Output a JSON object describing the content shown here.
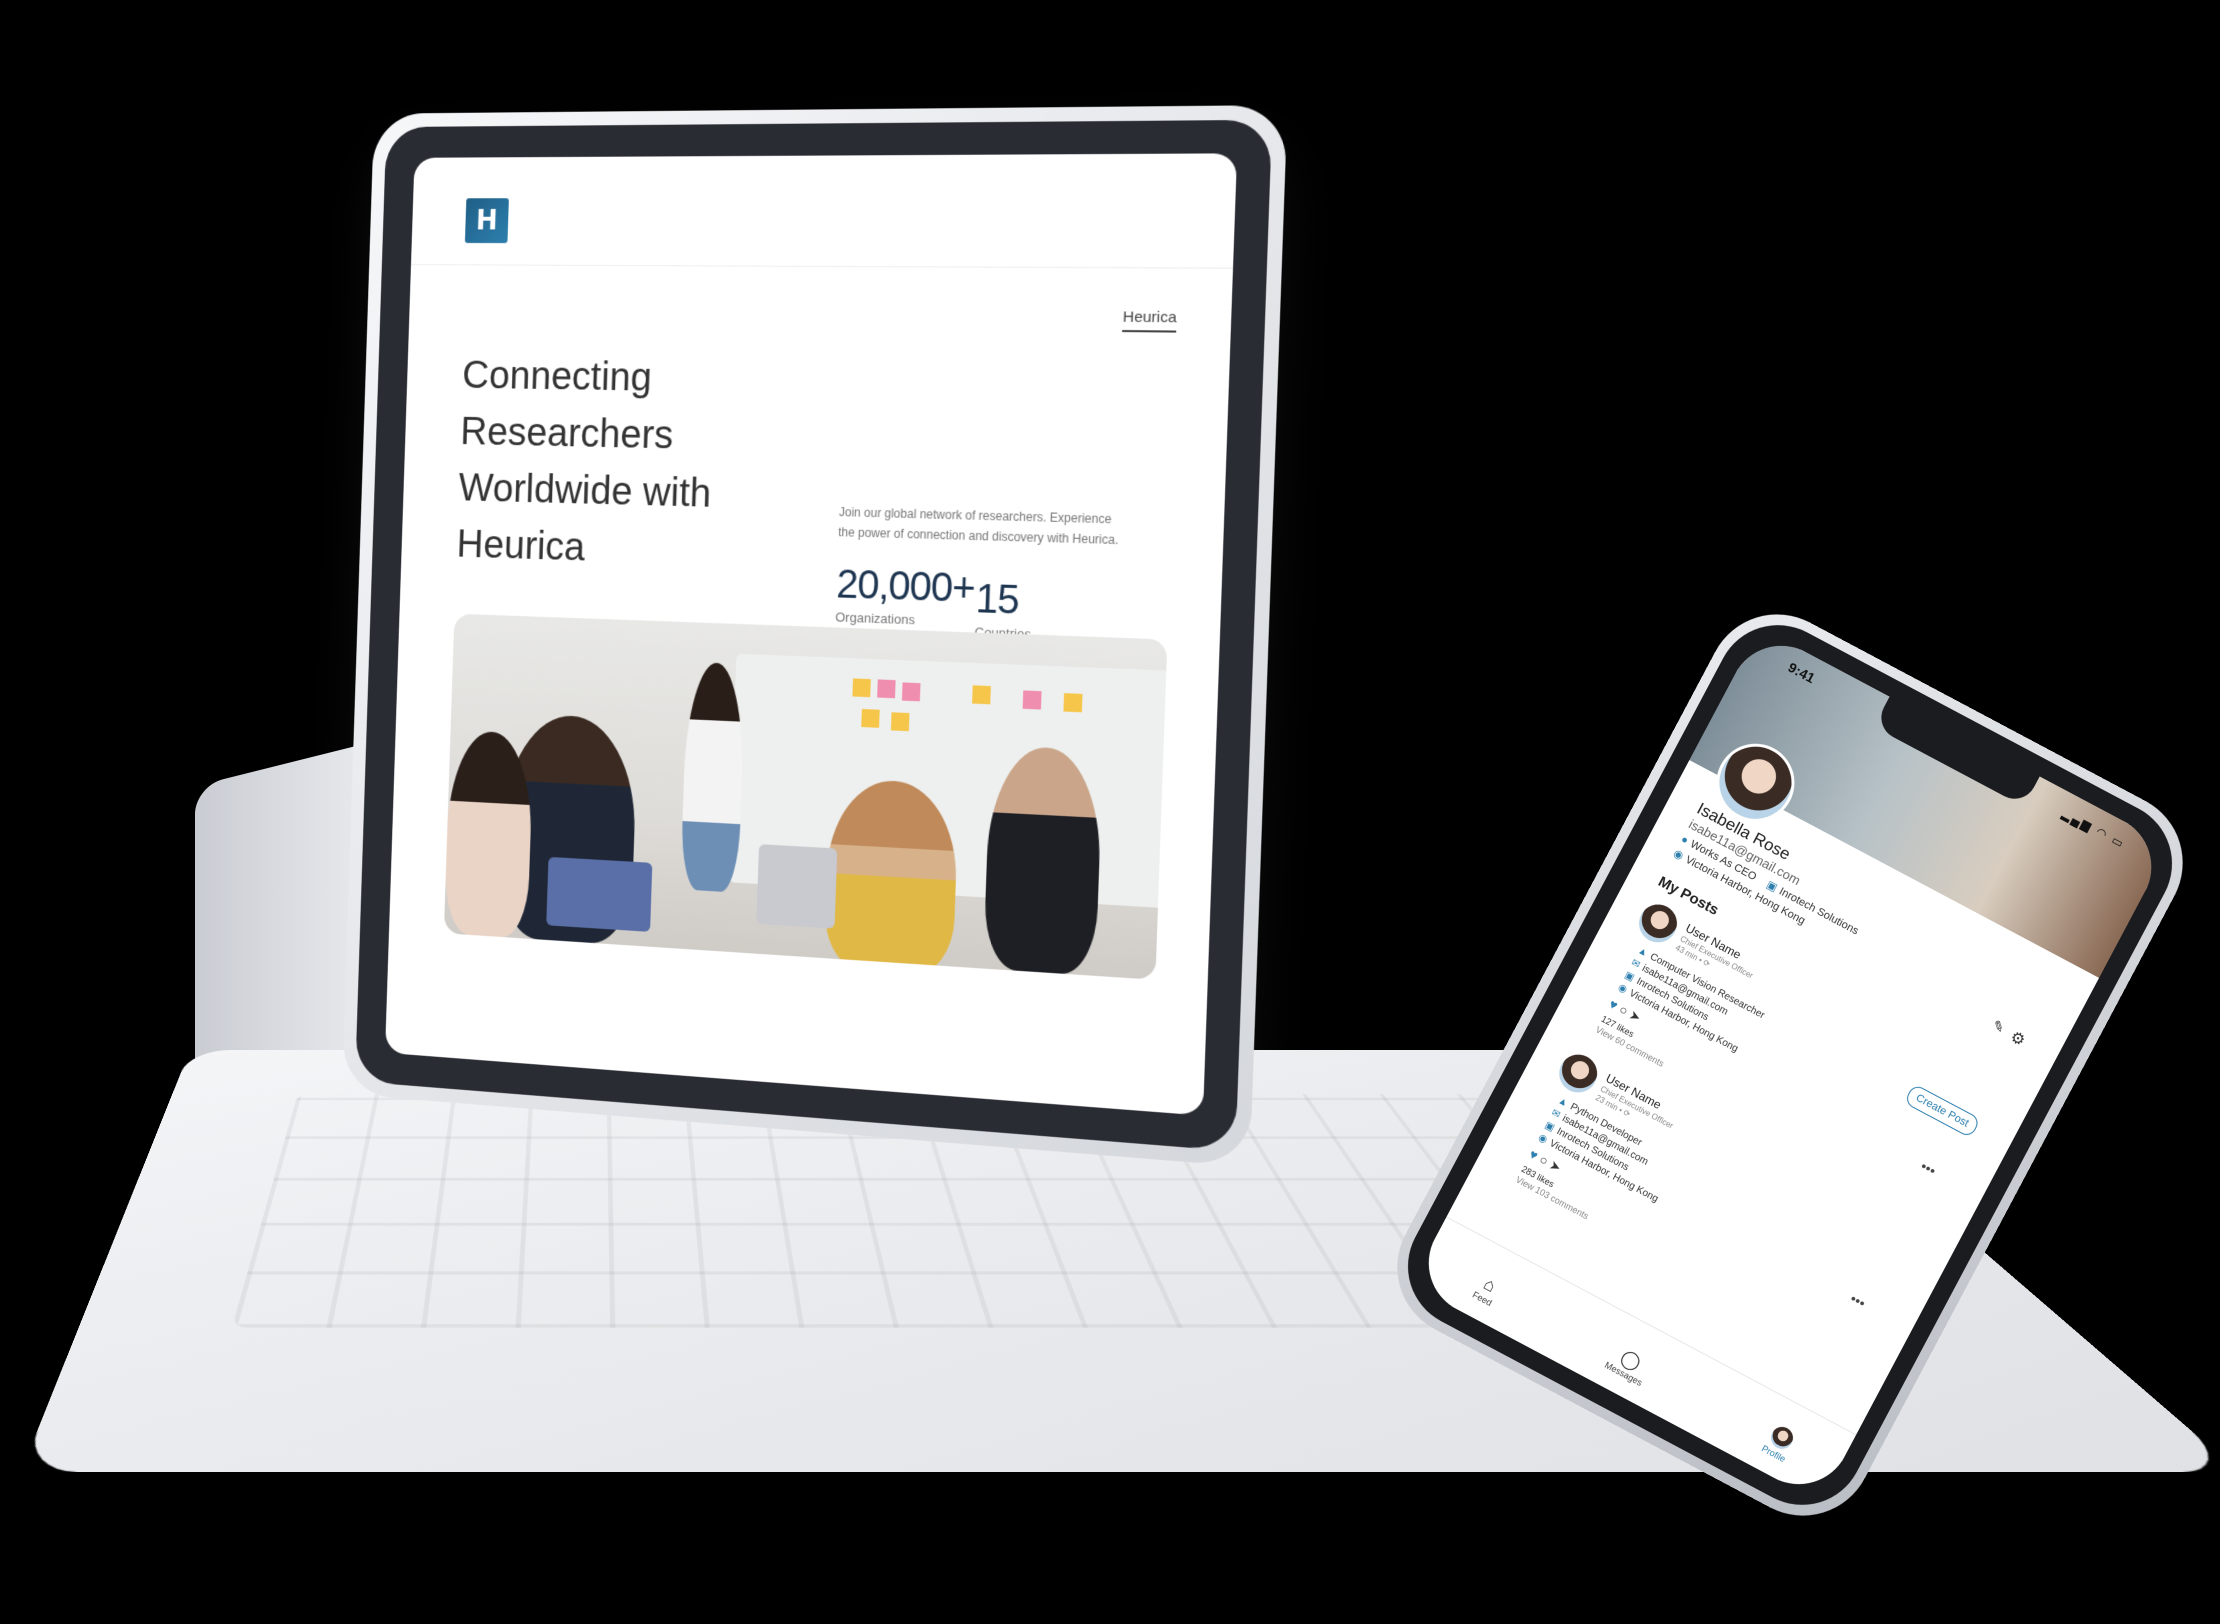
{
  "tablet": {
    "site": {
      "logo_glyph": "H",
      "nav_link": "Heurica",
      "hero_title": "Connecting Researchers Worldwide with Heurica",
      "hero_description": "Join our global network of researchers. Experience the power of connection and discovery with Heurica.",
      "stats": [
        {
          "value": "20,000+",
          "label": "Organizations"
        },
        {
          "value": "15",
          "label": "Countries"
        }
      ]
    }
  },
  "phone": {
    "status": {
      "time": "9:41",
      "icons": "▂▄▆ ◠ ▭"
    },
    "profile": {
      "name": "Isabella Rose",
      "email": "isabe11a@gmail.com",
      "role": "Works As CEO",
      "company": "Inrotech Solutions",
      "location": "Victoria Harbor, Hong Kong"
    },
    "section_title": "My Posts",
    "create_post_label": "Create Post",
    "posts": [
      {
        "user": "User Name",
        "role": "Chief Executive Officer",
        "time": "43 min • ⟳",
        "position": "Computer Vision Researcher",
        "email": "isabe11a@gmail.com",
        "company": "Inrotech Solutions",
        "location": "Victoria Harbor, Hong Kong",
        "likes": "127 likes",
        "comments": "View 60 comments"
      },
      {
        "user": "User Name",
        "role": "Chief Executive Officer",
        "time": "23 min • ⟳",
        "position": "Python Developer",
        "email": "isabe11a@gmail.com",
        "company": "Inrotech Solutions",
        "location": "Victoria Harbor, Hong Kong",
        "likes": "283 likes",
        "comments": "View 103 comments"
      }
    ],
    "tabs": [
      {
        "label": "Feed",
        "icon": "home-icon"
      },
      {
        "label": "Messages",
        "icon": "chat-icon"
      },
      {
        "label": "Profile",
        "icon": "avatar"
      }
    ],
    "accent_color": "#2d7fae"
  }
}
